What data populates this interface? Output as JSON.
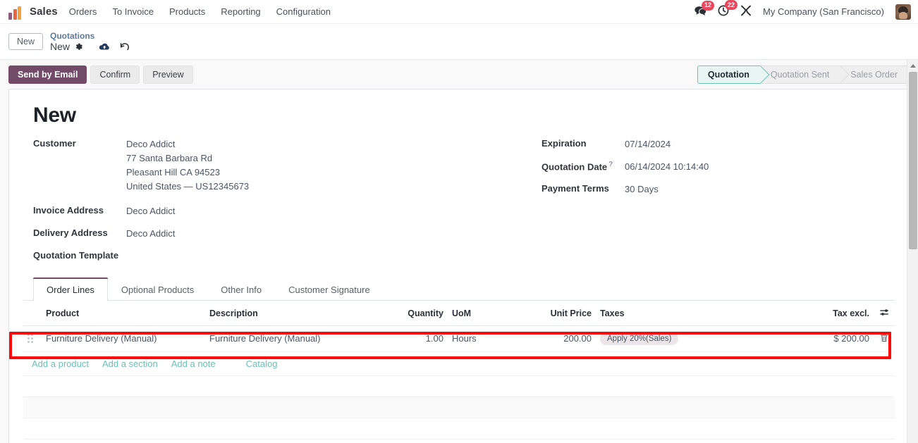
{
  "navbar": {
    "brand": "Sales",
    "logo_icon": "bar-chart-logo-icon",
    "menu": [
      {
        "label": "Orders"
      },
      {
        "label": "To Invoice"
      },
      {
        "label": "Products"
      },
      {
        "label": "Reporting"
      },
      {
        "label": "Configuration"
      }
    ],
    "messages_icon": "messages-icon",
    "messages_count": "12",
    "activities_icon": "activities-clock-icon",
    "activities_count": "22",
    "debug_icon": "debug-tools-icon",
    "company": "My Company (San Francisco)",
    "avatar_icon": "user-avatar"
  },
  "control_panel": {
    "new_button": "New",
    "breadcrumb_parent": "Quotations",
    "breadcrumb_current": "New",
    "gear_icon": "gear-icon",
    "save_icon": "cloud-save-icon",
    "discard_icon": "undo-discard-icon"
  },
  "actions": {
    "send_by_email": "Send by Email",
    "confirm": "Confirm",
    "preview": "Preview"
  },
  "statusbar": [
    {
      "label": "Quotation",
      "active": true
    },
    {
      "label": "Quotation Sent",
      "active": false
    },
    {
      "label": "Sales Order",
      "active": false
    }
  ],
  "record": {
    "title": "New",
    "left_fields": [
      {
        "label": "Customer",
        "value": "Deco Addict",
        "extra_lines": [
          "77 Santa Barbara Rd",
          "Pleasant Hill CA 94523",
          "United States — US12345673"
        ]
      },
      {
        "label": "Invoice Address",
        "value": "Deco Addict",
        "extra_lines": []
      },
      {
        "label": "Delivery Address",
        "value": "Deco Addict",
        "extra_lines": []
      },
      {
        "label": "Quotation Template",
        "value": "",
        "extra_lines": []
      }
    ],
    "right_fields": [
      {
        "label": "Expiration",
        "value": "07/14/2024",
        "help": ""
      },
      {
        "label": "Quotation Date",
        "value": "06/14/2024 10:14:40",
        "help": "?"
      },
      {
        "label": "Payment Terms",
        "value": "30 Days",
        "help": ""
      }
    ]
  },
  "notebook": {
    "tabs": [
      {
        "label": "Order Lines",
        "active": true
      },
      {
        "label": "Optional Products",
        "active": false
      },
      {
        "label": "Other Info",
        "active": false
      },
      {
        "label": "Customer Signature",
        "active": false
      }
    ]
  },
  "order_lines": {
    "columns": {
      "product": "Product",
      "description": "Description",
      "quantity": "Quantity",
      "uom": "UoM",
      "unit_price": "Unit Price",
      "taxes": "Taxes",
      "tax_excl": "Tax excl."
    },
    "optional_columns_icon": "optional-columns-toggle-icon",
    "rows": [
      {
        "drag_icon": "drag-handle-icon",
        "product": "Furniture Delivery (Manual)",
        "description": "Furniture Delivery (Manual)",
        "quantity": "1.00",
        "uom": "Hours",
        "unit_price": "200.00",
        "tax_badge": "Apply 20%(Sales)",
        "subtotal": "$ 200.00",
        "delete_icon": "trash-icon"
      }
    ],
    "links": {
      "add_product": "Add a product",
      "add_section": "Add a section",
      "add_note": "Add a note",
      "catalog": "Catalog"
    }
  },
  "annotation": {
    "highlight_color": "#fa0a0a"
  },
  "colors": {
    "primary": "#714b67",
    "accent_teal": "#6ec0b5",
    "badge_red": "#e6485d",
    "link_blue": "#5c7b9c"
  }
}
